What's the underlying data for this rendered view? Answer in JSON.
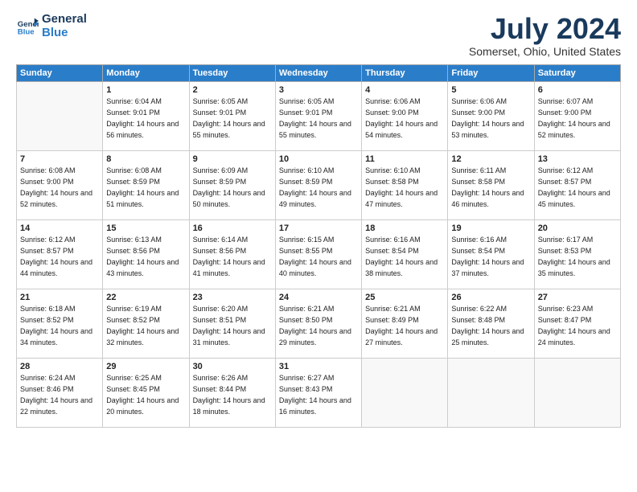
{
  "logo": {
    "line1": "General",
    "line2": "Blue"
  },
  "title": "July 2024",
  "location": "Somerset, Ohio, United States",
  "days_of_week": [
    "Sunday",
    "Monday",
    "Tuesday",
    "Wednesday",
    "Thursday",
    "Friday",
    "Saturday"
  ],
  "weeks": [
    [
      {
        "day": "",
        "empty": true
      },
      {
        "day": "1",
        "sunrise": "6:04 AM",
        "sunset": "9:01 PM",
        "daylight": "14 hours and 56 minutes."
      },
      {
        "day": "2",
        "sunrise": "6:05 AM",
        "sunset": "9:01 PM",
        "daylight": "14 hours and 55 minutes."
      },
      {
        "day": "3",
        "sunrise": "6:05 AM",
        "sunset": "9:01 PM",
        "daylight": "14 hours and 55 minutes."
      },
      {
        "day": "4",
        "sunrise": "6:06 AM",
        "sunset": "9:00 PM",
        "daylight": "14 hours and 54 minutes."
      },
      {
        "day": "5",
        "sunrise": "6:06 AM",
        "sunset": "9:00 PM",
        "daylight": "14 hours and 53 minutes."
      },
      {
        "day": "6",
        "sunrise": "6:07 AM",
        "sunset": "9:00 PM",
        "daylight": "14 hours and 52 minutes."
      }
    ],
    [
      {
        "day": "7",
        "sunrise": "6:08 AM",
        "sunset": "9:00 PM",
        "daylight": "14 hours and 52 minutes."
      },
      {
        "day": "8",
        "sunrise": "6:08 AM",
        "sunset": "8:59 PM",
        "daylight": "14 hours and 51 minutes."
      },
      {
        "day": "9",
        "sunrise": "6:09 AM",
        "sunset": "8:59 PM",
        "daylight": "14 hours and 50 minutes."
      },
      {
        "day": "10",
        "sunrise": "6:10 AM",
        "sunset": "8:59 PM",
        "daylight": "14 hours and 49 minutes."
      },
      {
        "day": "11",
        "sunrise": "6:10 AM",
        "sunset": "8:58 PM",
        "daylight": "14 hours and 47 minutes."
      },
      {
        "day": "12",
        "sunrise": "6:11 AM",
        "sunset": "8:58 PM",
        "daylight": "14 hours and 46 minutes."
      },
      {
        "day": "13",
        "sunrise": "6:12 AM",
        "sunset": "8:57 PM",
        "daylight": "14 hours and 45 minutes."
      }
    ],
    [
      {
        "day": "14",
        "sunrise": "6:12 AM",
        "sunset": "8:57 PM",
        "daylight": "14 hours and 44 minutes."
      },
      {
        "day": "15",
        "sunrise": "6:13 AM",
        "sunset": "8:56 PM",
        "daylight": "14 hours and 43 minutes."
      },
      {
        "day": "16",
        "sunrise": "6:14 AM",
        "sunset": "8:56 PM",
        "daylight": "14 hours and 41 minutes."
      },
      {
        "day": "17",
        "sunrise": "6:15 AM",
        "sunset": "8:55 PM",
        "daylight": "14 hours and 40 minutes."
      },
      {
        "day": "18",
        "sunrise": "6:16 AM",
        "sunset": "8:54 PM",
        "daylight": "14 hours and 38 minutes."
      },
      {
        "day": "19",
        "sunrise": "6:16 AM",
        "sunset": "8:54 PM",
        "daylight": "14 hours and 37 minutes."
      },
      {
        "day": "20",
        "sunrise": "6:17 AM",
        "sunset": "8:53 PM",
        "daylight": "14 hours and 35 minutes."
      }
    ],
    [
      {
        "day": "21",
        "sunrise": "6:18 AM",
        "sunset": "8:52 PM",
        "daylight": "14 hours and 34 minutes."
      },
      {
        "day": "22",
        "sunrise": "6:19 AM",
        "sunset": "8:52 PM",
        "daylight": "14 hours and 32 minutes."
      },
      {
        "day": "23",
        "sunrise": "6:20 AM",
        "sunset": "8:51 PM",
        "daylight": "14 hours and 31 minutes."
      },
      {
        "day": "24",
        "sunrise": "6:21 AM",
        "sunset": "8:50 PM",
        "daylight": "14 hours and 29 minutes."
      },
      {
        "day": "25",
        "sunrise": "6:21 AM",
        "sunset": "8:49 PM",
        "daylight": "14 hours and 27 minutes."
      },
      {
        "day": "26",
        "sunrise": "6:22 AM",
        "sunset": "8:48 PM",
        "daylight": "14 hours and 25 minutes."
      },
      {
        "day": "27",
        "sunrise": "6:23 AM",
        "sunset": "8:47 PM",
        "daylight": "14 hours and 24 minutes."
      }
    ],
    [
      {
        "day": "28",
        "sunrise": "6:24 AM",
        "sunset": "8:46 PM",
        "daylight": "14 hours and 22 minutes."
      },
      {
        "day": "29",
        "sunrise": "6:25 AM",
        "sunset": "8:45 PM",
        "daylight": "14 hours and 20 minutes."
      },
      {
        "day": "30",
        "sunrise": "6:26 AM",
        "sunset": "8:44 PM",
        "daylight": "14 hours and 18 minutes."
      },
      {
        "day": "31",
        "sunrise": "6:27 AM",
        "sunset": "8:43 PM",
        "daylight": "14 hours and 16 minutes."
      },
      {
        "day": "",
        "empty": true
      },
      {
        "day": "",
        "empty": true
      },
      {
        "day": "",
        "empty": true
      }
    ]
  ]
}
